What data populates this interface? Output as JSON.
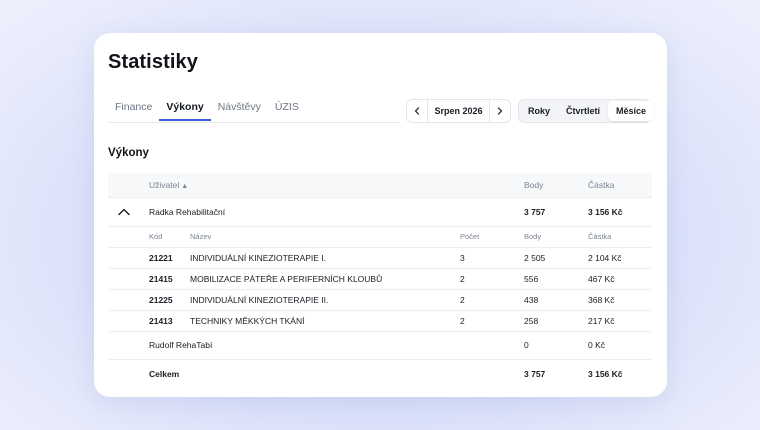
{
  "page": {
    "title": "Statistiky"
  },
  "tabs": [
    {
      "label": "Finance"
    },
    {
      "label": "Výkony"
    },
    {
      "label": "Návštěvy"
    },
    {
      "label": "ÚZIS"
    }
  ],
  "month_nav": {
    "label": "Srpen 2026"
  },
  "period": {
    "options": [
      "Roky",
      "Čtvrtletí",
      "Měsíce"
    ],
    "selected": "Měsíce"
  },
  "section": {
    "title": "Výkony"
  },
  "table": {
    "headers": {
      "user": "Uživatel",
      "body": "Body",
      "amount": "Částka"
    },
    "users": [
      {
        "name": "Radka Rehabilitační",
        "body": "3 757",
        "amount": "3 156 Kč",
        "expanded": true,
        "sub_headers": {
          "kod": "Kód",
          "nazev": "Název",
          "pocet": "Počet",
          "body": "Body",
          "amount": "Částka"
        },
        "items": [
          {
            "kod": "21221",
            "nazev": "INDIVIDUÁLNÍ KINEZIOTERAPIE I.",
            "pocet": "3",
            "body": "2 505",
            "amount": "2 104 Kč"
          },
          {
            "kod": "21415",
            "nazev": "MOBILIZACE PÁTEŘE A PERIFERNÍCH KLOUBŮ",
            "pocet": "2",
            "body": "556",
            "amount": "467 Kč"
          },
          {
            "kod": "21225",
            "nazev": "INDIVIDUÁLNÍ KINEZIOTERAPIE II.",
            "pocet": "2",
            "body": "438",
            "amount": "368 Kč"
          },
          {
            "kod": "21413",
            "nazev": "TECHNIKY MĚKKÝCH TKÁNÍ",
            "pocet": "2",
            "body": "258",
            "amount": "217 Kč"
          }
        ]
      },
      {
        "name": "Rudolf RehaTabí",
        "body": "0",
        "amount": "0 Kč"
      }
    ],
    "total": {
      "label": "Celkem",
      "body": "3 757",
      "amount": "3 156 Kč"
    }
  },
  "icons": {
    "collapse": "chevron-up-icon",
    "prev": "chevron-left-icon",
    "next": "chevron-right-icon",
    "sort": "sort-asc-icon"
  },
  "colors": {
    "accent": "#3c5fd8"
  }
}
